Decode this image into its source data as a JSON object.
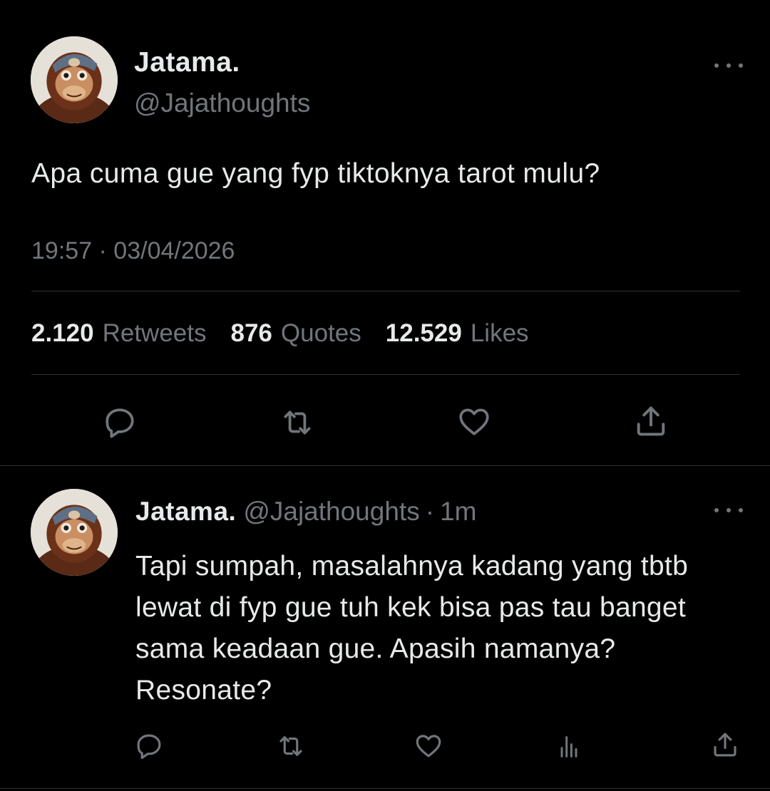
{
  "main_tweet": {
    "author_name": "Jatama.",
    "author_handle": "@Jajathoughts",
    "text": "Apa cuma gue yang fyp tiktoknya tarot mulu?",
    "timestamp": "19:57 · 03/04/2026",
    "stats": {
      "retweets_count": "2.120",
      "retweets_label": "Retweets",
      "quotes_count": "876",
      "quotes_label": "Quotes",
      "likes_count": "12.529",
      "likes_label": "Likes"
    },
    "actions": [
      "reply-icon",
      "retweet-icon",
      "like-icon",
      "share-icon"
    ]
  },
  "reply_tweet": {
    "author_name": "Jatama.",
    "author_handle": "@Jajathoughts",
    "separator": "·",
    "time_ago": "1m",
    "text": "Tapi sumpah, masalahnya kadang yang tbtb lewat di fyp gue tuh kek bisa pas tau banget sama keadaan gue. Apasih namanya? Resonate?",
    "actions": [
      "reply-icon",
      "retweet-icon",
      "like-icon",
      "analytics-icon",
      "share-icon"
    ]
  },
  "colors": {
    "background": "#000000",
    "primary_text": "#e7e9ea",
    "secondary_text": "#71767b",
    "divider": "#2f3336"
  }
}
